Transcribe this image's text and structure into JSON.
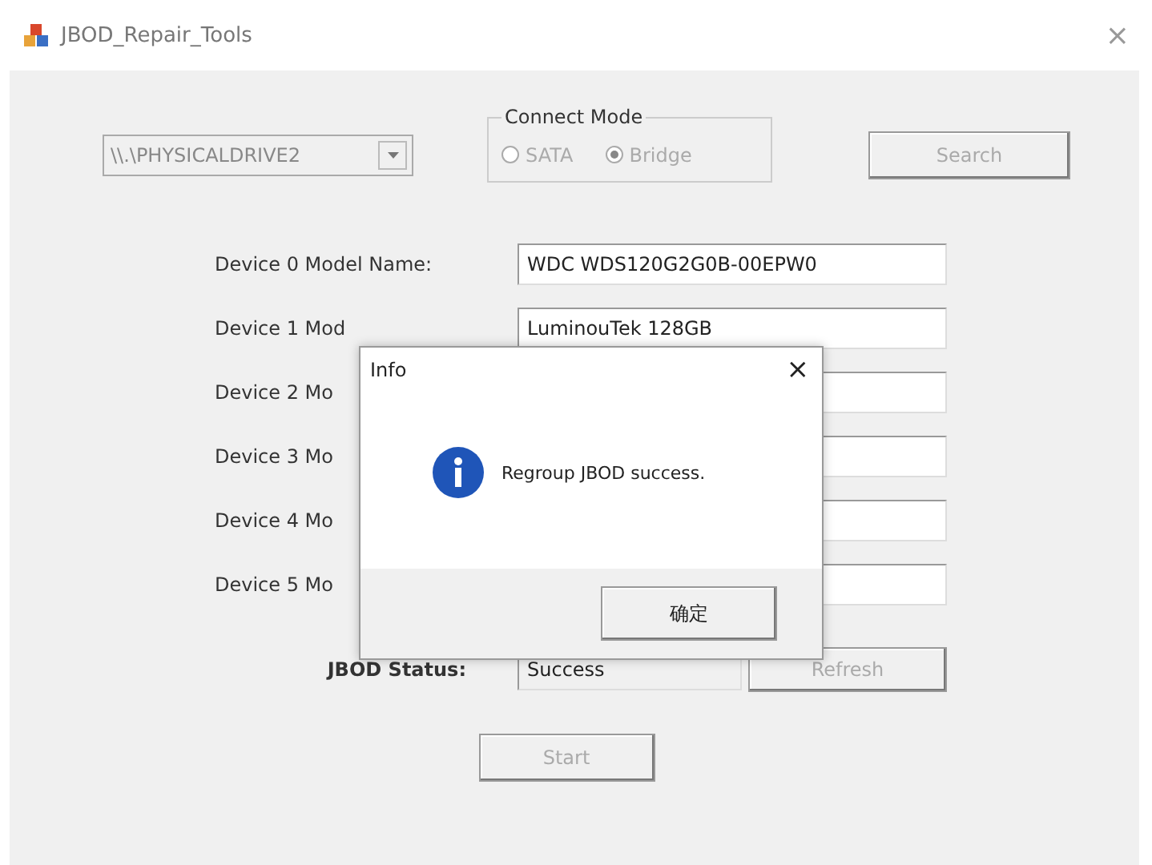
{
  "window": {
    "title": "JBOD_Repair_Tools",
    "close": "×"
  },
  "drive_select": {
    "value": "\\\\.\\PHYSICALDRIVE2",
    "disabled": true
  },
  "connect_mode": {
    "title": "Connect Mode",
    "options": [
      {
        "label": "SATA",
        "selected": false,
        "disabled": true
      },
      {
        "label": "Bridge",
        "selected": true,
        "disabled": true
      }
    ]
  },
  "search_button": {
    "label": "Search",
    "disabled": true
  },
  "devices": [
    {
      "label": "Device 0 Model Name:",
      "value": "WDC WDS120G2G0B-00EPW0"
    },
    {
      "label": "Device 1 Mod",
      "value": "LuminouTek  128GB"
    },
    {
      "label": "Device 2 Mo"
    },
    {
      "label": "Device 3 Mo"
    },
    {
      "label": "Device 4 Mo"
    },
    {
      "label": "Device 5 Mo"
    }
  ],
  "status": {
    "label": "JBOD Status:",
    "value": "Success",
    "refresh": {
      "label": "Refresh",
      "disabled": true
    }
  },
  "start_button": {
    "label": "Start",
    "disabled": true
  },
  "dialog": {
    "title": "Info",
    "close": "×",
    "message": "Regroup JBOD success.",
    "ok": "确定"
  }
}
